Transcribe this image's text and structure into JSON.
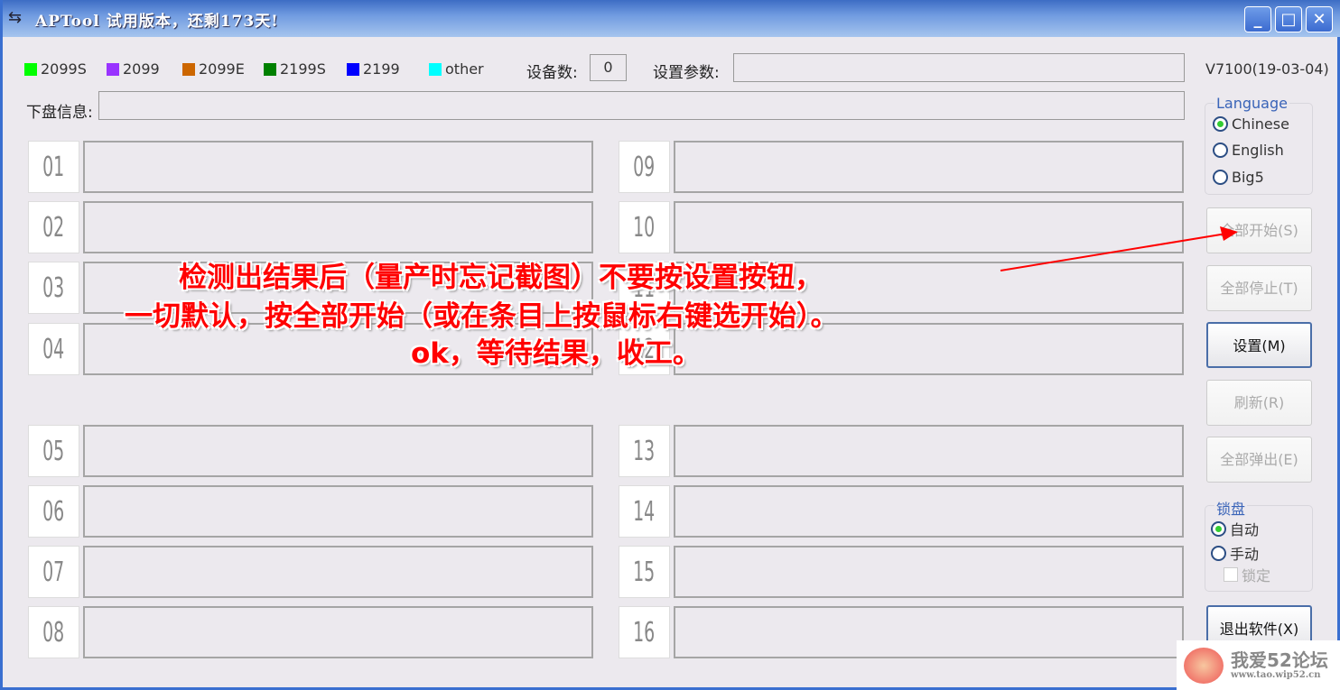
{
  "window": {
    "title": "APTool   试用版本，还剩173天!",
    "min": "_",
    "max": "□",
    "close": "✕"
  },
  "legend": [
    {
      "label": "2099S",
      "color": "#00ff00"
    },
    {
      "label": "2099",
      "color": "#9933ff"
    },
    {
      "label": "2099E",
      "color": "#cc6600"
    },
    {
      "label": "2199S",
      "color": "#008000"
    },
    {
      "label": "2199",
      "color": "#0000ff"
    },
    {
      "label": "other",
      "color": "#00ffff"
    }
  ],
  "device_count_label": "设备数:",
  "device_count": "0",
  "settings_label": "设置参数:",
  "settings_value": "",
  "version": "V7100(19-03-04)",
  "disk_info_label": "下盘信息:",
  "disk_info_value": "",
  "slots": [
    "01",
    "02",
    "03",
    "04",
    "05",
    "06",
    "07",
    "08",
    "09",
    "10",
    "11",
    "12",
    "13",
    "14",
    "15",
    "16"
  ],
  "language": {
    "title": "Language",
    "options": [
      "Chinese",
      "English",
      "Big5"
    ],
    "selected": "Chinese"
  },
  "buttons": {
    "start_all": "全部开始(S)",
    "stop_all": "全部停止(T)",
    "settings": "设置(M)",
    "refresh": "刷新(R)",
    "eject_all": "全部弹出(E)",
    "exit": "退出软件(X)"
  },
  "lock": {
    "title": "锁盘",
    "options": [
      "自动",
      "手动"
    ],
    "selected": "自动",
    "lock_checkbox": "锁定"
  },
  "annotation": {
    "line1": "检测出结果后（量产时忘记截图）不要按设置按钮，",
    "line2": "一切默认，按全部开始（或在条目上按鼠标右键选开始）。",
    "line3": "ok，等待结果，收工。"
  },
  "watermark": {
    "text": "我爱52论坛",
    "url": "www.tao.wip52.cn"
  }
}
